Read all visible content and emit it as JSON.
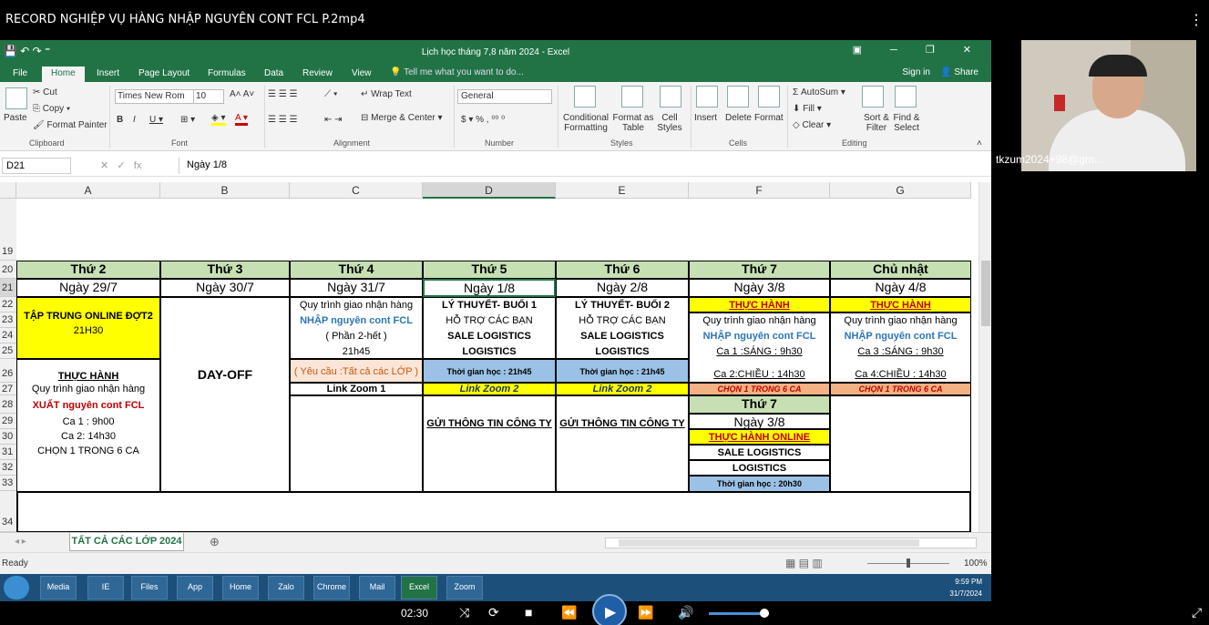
{
  "player": {
    "title": "RECORD NGHIỆP VỤ HÀNG NHẬP NGUYÊN CONT FCL P.2mp4",
    "time": "02:30",
    "menu_icon": "⋮"
  },
  "excel": {
    "window_title": "Lịch học tháng 7,8 năm  2024 - Excel",
    "tabs": [
      "File",
      "Home",
      "Insert",
      "Page Layout",
      "Formulas",
      "Data",
      "Review",
      "View"
    ],
    "tell_me": "Tell me what you want to do...",
    "sign_in": "Sign in",
    "share": "Share",
    "ribbon": {
      "paste": "Paste",
      "cut": "Cut",
      "copy": "Copy",
      "format_painter": "Format Painter",
      "clipboard": "Clipboard",
      "font_name": "Times New Rom",
      "font_size": "10",
      "font": "Font",
      "wrap_text": "Wrap Text",
      "merge_center": "Merge & Center",
      "alignment": "Alignment",
      "number_format": "General",
      "number": "Number",
      "conditional": "Conditional Formatting",
      "format_table": "Format as Table",
      "cell_styles": "Cell Styles",
      "styles": "Styles",
      "insert": "Insert",
      "delete": "Delete",
      "format": "Format",
      "cells": "Cells",
      "autosum": "AutoSum",
      "fill": "Fill",
      "clear": "Clear",
      "sort_filter": "Sort & Filter",
      "find_select": "Find & Select",
      "editing": "Editing"
    },
    "name_box": "D21",
    "formula": "Ngày 1/8",
    "columns": [
      "A",
      "B",
      "C",
      "D",
      "E",
      "F",
      "G"
    ],
    "rows": [
      "19",
      "20",
      "21",
      "22",
      "23",
      "24",
      "25",
      "26",
      "27",
      "28",
      "29",
      "30",
      "31",
      "32",
      "33",
      "34"
    ],
    "weekdays": [
      "Thứ 2",
      "Thứ 3",
      "Thứ 4",
      "Thứ 5",
      "Thứ 6",
      "Thứ 7",
      "Chủ nhật"
    ],
    "dates": [
      "Ngày 29/7",
      "Ngày 30/7",
      "Ngày 31/7",
      "Ngày 1/8",
      "Ngày 2/8",
      "Ngày 3/8",
      "Ngày 4/8"
    ],
    "cells": {
      "a_online": "TẬP TRUNG ONLINE  ĐỢT2",
      "a_time": "21H30",
      "a_practice": "THỰC HÀNH",
      "a_process": "Quy trình giao nhận hàng",
      "a_export": "XUẤT nguyên cont FCL",
      "a_ca1": "Ca 1 : 9h00",
      "a_ca2": "Ca 2:  14h30",
      "a_choose": "CHỌN 1 TRONG 6 CA",
      "b_dayoff": "DAY-OFF",
      "c_process": "Quy trình giao nhận hàng",
      "c_import": "NHẬP nguyên cont FCL",
      "c_part": "( Phần 2-hết )",
      "c_time": "21h45",
      "c_req": "( Yêu cầu :Tất cả các LỚP )",
      "c_zoom": "Link Zoom 1",
      "d_theory": "LÝ THUYẾT- BUỔI 1",
      "d_support": "HỖ TRỢ CÁC BẠN",
      "d_sale": "SALE LOGISTICS",
      "d_logistics": "LOGISTICS",
      "d_time": "Thời gian học : 21h45",
      "d_zoom": "Link Zoom 2",
      "d_send": "GỬI THÔNG TIN CÔNG TY",
      "e_theory": "LÝ THUYẾT- BUỔI 2",
      "e_support": "HỖ TRỢ CÁC BẠN",
      "e_sale": "SALE LOGISTICS",
      "e_logistics": "LOGISTICS",
      "e_time": "Thời gian học : 21h45",
      "e_zoom": "Link Zoom 2",
      "e_send": "GỬI THÔNG TIN CÔNG TY",
      "f_practice": "THỰC HÀNH",
      "f_process": "Quy trình giao nhận hàng",
      "f_import": "NHẬP nguyên cont FCL",
      "f_ca1": "Ca 1 :SÁNG : 9h30",
      "f_ca2": "Ca 2:CHIỀU  :  14h30",
      "f_choose": "CHỌN 1 TRONG 6 CA",
      "f_weekday2": "Thứ 7",
      "f_date2": "Ngày 3/8",
      "f_online": "THỰC HÀNH ONLINE",
      "f_sale": "SALE LOGISTICS",
      "f_logistics": "LOGISTICS",
      "f_time2": "Thời gian học : 20h30",
      "g_practice": "THỰC HÀNH",
      "g_process": "Quy trình giao nhận hàng",
      "g_import": "NHẬP nguyên cont FCL",
      "g_ca3": "Ca 3 :SÁNG : 9h30",
      "g_ca4": "Ca 4:CHIỀU :  14h30",
      "g_choose": "CHỌN 1 TRONG 6 CA"
    },
    "sheet_tab": "TẤT CẢ CÁC LỚP 2024",
    "status": "Ready",
    "zoom": "100%"
  },
  "taskbar": {
    "apps": [
      "Media",
      "IE",
      "Files",
      "App",
      "Home",
      "Zalo",
      "Chrome",
      "Mail",
      "Excel",
      "Zoom"
    ],
    "time": "9:59 PM",
    "date": "31/7/2024"
  },
  "webcam": {
    "name": "tkzum2024+98@gm..."
  }
}
